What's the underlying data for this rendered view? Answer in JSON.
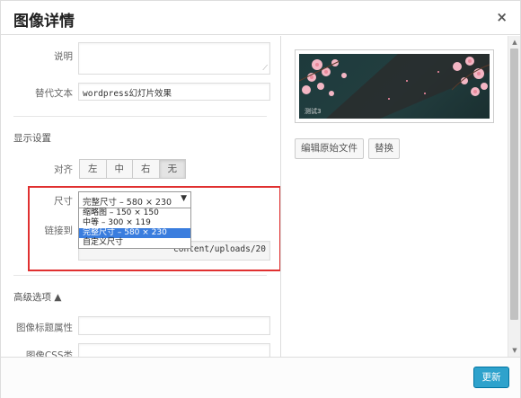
{
  "dialog": {
    "title": "图像详情",
    "close_symbol": "×"
  },
  "form": {
    "caption_label": "说明",
    "caption_value": "",
    "alt_label": "替代文本",
    "alt_value": "wordpress幻灯片效果",
    "display_section": "显示设置",
    "align_label": "对齐",
    "align_options": [
      "左",
      "中",
      "右",
      "无"
    ],
    "align_selected": "无",
    "size_label": "尺寸",
    "size_selected": "完整尺寸 – 580 × 230",
    "size_options": [
      "缩略图 – 150 × 150",
      "中等 – 300 × 119",
      "完整尺寸 – 580 × 230",
      "自定义尺寸"
    ],
    "link_label": "链接到",
    "link_value": "content/uploads/20",
    "advanced_section": "高级选项 ▲",
    "image_title_label": "图像标题属性",
    "image_css_label": "图像CSS类"
  },
  "preview": {
    "edit_original_label": "编辑原始文件",
    "replace_label": "替换",
    "thumbnail_caption": "测试3"
  },
  "footer": {
    "update_label": "更新"
  },
  "colors": {
    "accent": "#2ea2cc",
    "highlight_border": "#e03030",
    "selected_option": "#3a7dde"
  }
}
